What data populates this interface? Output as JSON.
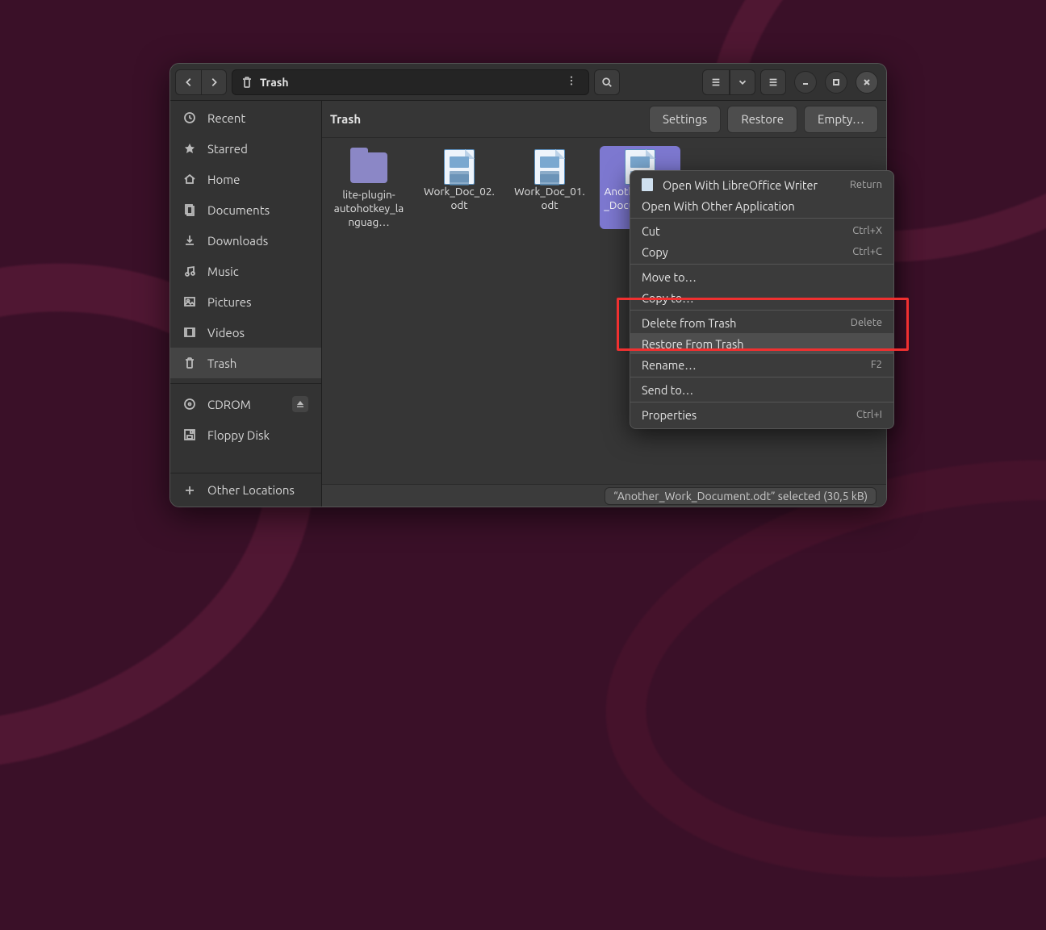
{
  "header": {
    "path_label": "Trash"
  },
  "sidebar": {
    "items": [
      {
        "label": "Recent",
        "icon": "clock-icon"
      },
      {
        "label": "Starred",
        "icon": "star-icon"
      },
      {
        "label": "Home",
        "icon": "home-icon"
      },
      {
        "label": "Documents",
        "icon": "documents-icon"
      },
      {
        "label": "Downloads",
        "icon": "downloads-icon"
      },
      {
        "label": "Music",
        "icon": "music-icon"
      },
      {
        "label": "Pictures",
        "icon": "pictures-icon"
      },
      {
        "label": "Videos",
        "icon": "videos-icon"
      },
      {
        "label": "Trash",
        "icon": "trash-icon"
      },
      {
        "label": "CDROM",
        "icon": "disc-icon"
      },
      {
        "label": "Floppy Disk",
        "icon": "floppy-icon"
      }
    ],
    "other_locations": "Other Locations"
  },
  "actionbar": {
    "title": "Trash",
    "settings": "Settings",
    "restore": "Restore",
    "empty": "Empty…"
  },
  "files": [
    {
      "name": "lite-plugin-autohotkey_languag…",
      "type": "folder",
      "selected": false
    },
    {
      "name": "Work_Doc_02.odt",
      "type": "document",
      "selected": false
    },
    {
      "name": "Work_Doc_01.odt",
      "type": "document",
      "selected": false
    },
    {
      "name": "Another_Work_Document.odt",
      "type": "document",
      "selected": true
    }
  ],
  "status": {
    "text": "“Another_Work_Document.odt” selected  (30,5 kB)"
  },
  "context_menu": {
    "open_with_writer": "Open With LibreOffice Writer",
    "open_with_writer_key": "Return",
    "open_with_other": "Open With Other Application",
    "cut": "Cut",
    "cut_key": "Ctrl+X",
    "copy": "Copy",
    "copy_key": "Ctrl+C",
    "move_to": "Move to…",
    "copy_to": "Copy to…",
    "delete_from_trash": "Delete from Trash",
    "delete_key": "Delete",
    "restore_from_trash": "Restore From Trash",
    "rename": "Rename…",
    "rename_key": "F2",
    "send_to": "Send to…",
    "properties": "Properties",
    "properties_key": "Ctrl+I"
  }
}
